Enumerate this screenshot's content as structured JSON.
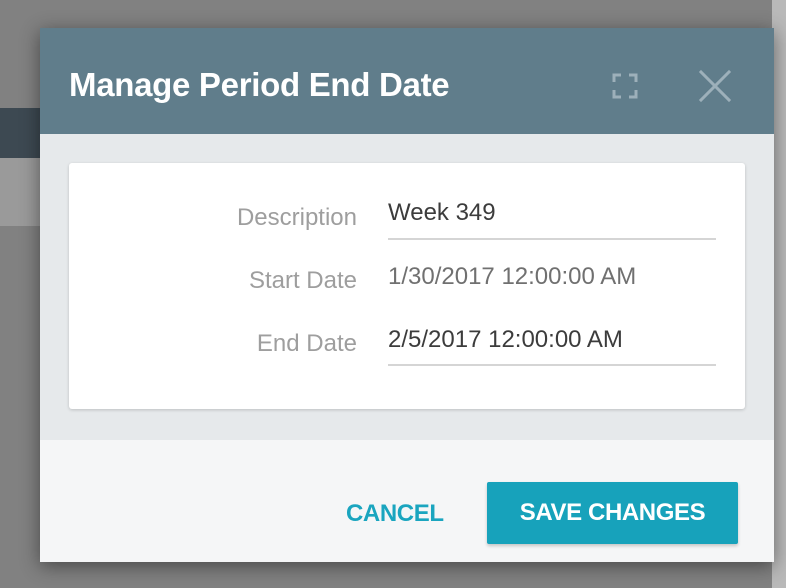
{
  "dialog": {
    "title": "Manage Period End Date",
    "header_color": "#607d8b",
    "icons": {
      "maximize": "maximize-icon",
      "close": "close-icon"
    }
  },
  "form": {
    "description": {
      "label": "Description",
      "value": "Week 349"
    },
    "start_date": {
      "label": "Start Date",
      "value": "1/30/2017 12:00:00 AM"
    },
    "end_date": {
      "label": "End Date",
      "value": "2/5/2017 12:00:00 AM"
    }
  },
  "footer": {
    "cancel_label": "CANCEL",
    "save_label": "SAVE CHANGES",
    "accent_color": "#17a2bb"
  }
}
